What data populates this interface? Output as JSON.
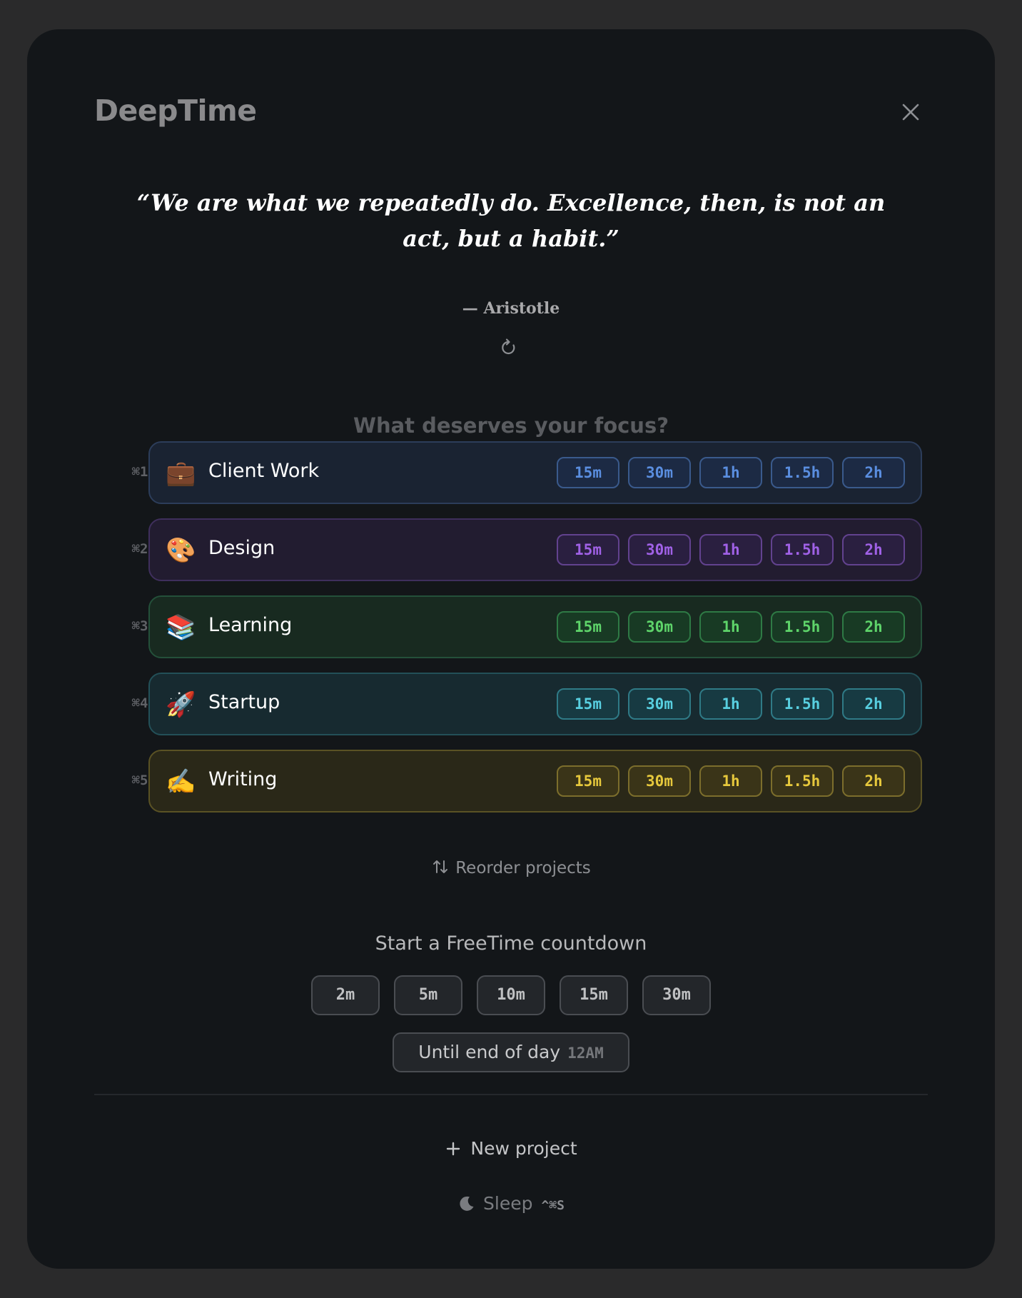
{
  "app": {
    "title": "DeepTime"
  },
  "quote": {
    "text": "“We are what we repeatedly do. Excellence, then, is not an act, but a habit.”",
    "author": "— Aristotle"
  },
  "focus": {
    "heading": "What deserves your focus?"
  },
  "projects": [
    {
      "shortcut": "⌘1",
      "emoji": "💼",
      "name": "Client Work",
      "colors": {
        "bg": "#1a2332",
        "border": "#2c3d5a",
        "btn_bg": "#1c2a44",
        "btn_border": "#3a5a8c",
        "btn_text": "#5a8ee0"
      }
    },
    {
      "shortcut": "⌘2",
      "emoji": "🎨",
      "name": "Design",
      "colors": {
        "bg": "#221c30",
        "border": "#3f2f5c",
        "btn_bg": "#2a1f40",
        "btn_border": "#62428f",
        "btn_text": "#a061e6"
      }
    },
    {
      "shortcut": "⌘3",
      "emoji": "📚",
      "name": "Learning",
      "colors": {
        "bg": "#182a20",
        "border": "#24503a",
        "btn_bg": "#183a24",
        "btn_border": "#2e7a45",
        "btn_text": "#5ed46a"
      }
    },
    {
      "shortcut": "⌘4",
      "emoji": "🚀",
      "name": "Startup",
      "colors": {
        "bg": "#172a30",
        "border": "#235058",
        "btn_bg": "#173a42",
        "btn_border": "#2f7a86",
        "btn_text": "#58cfe0"
      }
    },
    {
      "shortcut": "⌘5",
      "emoji": "✍️",
      "name": "Writing",
      "colors": {
        "bg": "#2a2818",
        "border": "#5a5224",
        "btn_bg": "#3a3418",
        "btn_border": "#7c6e2c",
        "btn_text": "#e6c83c"
      }
    }
  ],
  "durations": [
    "15m",
    "30m",
    "1h",
    "1.5h",
    "2h"
  ],
  "reorder": {
    "label": "Reorder projects"
  },
  "freetime": {
    "heading": "Start a FreeTime countdown",
    "options": [
      "2m",
      "5m",
      "10m",
      "15m",
      "30m"
    ],
    "end_of_day": {
      "label": "Until end of day",
      "time": "12AM"
    }
  },
  "footer": {
    "new_project": "New project",
    "sleep": {
      "label": "Sleep",
      "shortcut": "^⌘S"
    }
  },
  "icons": {
    "close": "close-icon",
    "refresh": "refresh-icon",
    "reorder": "sort-arrows-icon",
    "plus": "plus-icon",
    "moon": "moon-icon"
  }
}
